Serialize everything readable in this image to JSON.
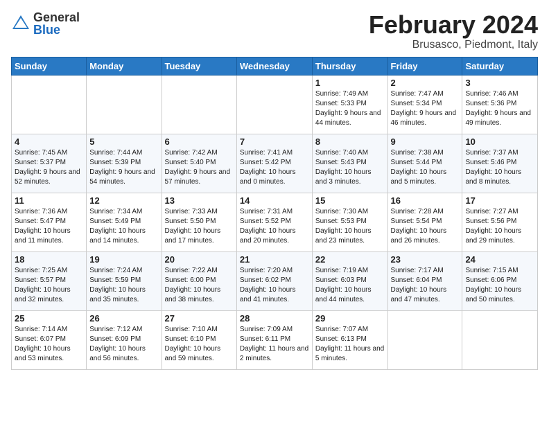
{
  "logo": {
    "general": "General",
    "blue": "Blue"
  },
  "header": {
    "month": "February 2024",
    "location": "Brusasco, Piedmont, Italy"
  },
  "weekdays": [
    "Sunday",
    "Monday",
    "Tuesday",
    "Wednesday",
    "Thursday",
    "Friday",
    "Saturday"
  ],
  "weeks": [
    [
      {
        "day": "",
        "info": ""
      },
      {
        "day": "",
        "info": ""
      },
      {
        "day": "",
        "info": ""
      },
      {
        "day": "",
        "info": ""
      },
      {
        "day": "1",
        "info": "Sunrise: 7:49 AM\nSunset: 5:33 PM\nDaylight: 9 hours and 44 minutes."
      },
      {
        "day": "2",
        "info": "Sunrise: 7:47 AM\nSunset: 5:34 PM\nDaylight: 9 hours and 46 minutes."
      },
      {
        "day": "3",
        "info": "Sunrise: 7:46 AM\nSunset: 5:36 PM\nDaylight: 9 hours and 49 minutes."
      }
    ],
    [
      {
        "day": "4",
        "info": "Sunrise: 7:45 AM\nSunset: 5:37 PM\nDaylight: 9 hours and 52 minutes."
      },
      {
        "day": "5",
        "info": "Sunrise: 7:44 AM\nSunset: 5:39 PM\nDaylight: 9 hours and 54 minutes."
      },
      {
        "day": "6",
        "info": "Sunrise: 7:42 AM\nSunset: 5:40 PM\nDaylight: 9 hours and 57 minutes."
      },
      {
        "day": "7",
        "info": "Sunrise: 7:41 AM\nSunset: 5:42 PM\nDaylight: 10 hours and 0 minutes."
      },
      {
        "day": "8",
        "info": "Sunrise: 7:40 AM\nSunset: 5:43 PM\nDaylight: 10 hours and 3 minutes."
      },
      {
        "day": "9",
        "info": "Sunrise: 7:38 AM\nSunset: 5:44 PM\nDaylight: 10 hours and 5 minutes."
      },
      {
        "day": "10",
        "info": "Sunrise: 7:37 AM\nSunset: 5:46 PM\nDaylight: 10 hours and 8 minutes."
      }
    ],
    [
      {
        "day": "11",
        "info": "Sunrise: 7:36 AM\nSunset: 5:47 PM\nDaylight: 10 hours and 11 minutes."
      },
      {
        "day": "12",
        "info": "Sunrise: 7:34 AM\nSunset: 5:49 PM\nDaylight: 10 hours and 14 minutes."
      },
      {
        "day": "13",
        "info": "Sunrise: 7:33 AM\nSunset: 5:50 PM\nDaylight: 10 hours and 17 minutes."
      },
      {
        "day": "14",
        "info": "Sunrise: 7:31 AM\nSunset: 5:52 PM\nDaylight: 10 hours and 20 minutes."
      },
      {
        "day": "15",
        "info": "Sunrise: 7:30 AM\nSunset: 5:53 PM\nDaylight: 10 hours and 23 minutes."
      },
      {
        "day": "16",
        "info": "Sunrise: 7:28 AM\nSunset: 5:54 PM\nDaylight: 10 hours and 26 minutes."
      },
      {
        "day": "17",
        "info": "Sunrise: 7:27 AM\nSunset: 5:56 PM\nDaylight: 10 hours and 29 minutes."
      }
    ],
    [
      {
        "day": "18",
        "info": "Sunrise: 7:25 AM\nSunset: 5:57 PM\nDaylight: 10 hours and 32 minutes."
      },
      {
        "day": "19",
        "info": "Sunrise: 7:24 AM\nSunset: 5:59 PM\nDaylight: 10 hours and 35 minutes."
      },
      {
        "day": "20",
        "info": "Sunrise: 7:22 AM\nSunset: 6:00 PM\nDaylight: 10 hours and 38 minutes."
      },
      {
        "day": "21",
        "info": "Sunrise: 7:20 AM\nSunset: 6:02 PM\nDaylight: 10 hours and 41 minutes."
      },
      {
        "day": "22",
        "info": "Sunrise: 7:19 AM\nSunset: 6:03 PM\nDaylight: 10 hours and 44 minutes."
      },
      {
        "day": "23",
        "info": "Sunrise: 7:17 AM\nSunset: 6:04 PM\nDaylight: 10 hours and 47 minutes."
      },
      {
        "day": "24",
        "info": "Sunrise: 7:15 AM\nSunset: 6:06 PM\nDaylight: 10 hours and 50 minutes."
      }
    ],
    [
      {
        "day": "25",
        "info": "Sunrise: 7:14 AM\nSunset: 6:07 PM\nDaylight: 10 hours and 53 minutes."
      },
      {
        "day": "26",
        "info": "Sunrise: 7:12 AM\nSunset: 6:09 PM\nDaylight: 10 hours and 56 minutes."
      },
      {
        "day": "27",
        "info": "Sunrise: 7:10 AM\nSunset: 6:10 PM\nDaylight: 10 hours and 59 minutes."
      },
      {
        "day": "28",
        "info": "Sunrise: 7:09 AM\nSunset: 6:11 PM\nDaylight: 11 hours and 2 minutes."
      },
      {
        "day": "29",
        "info": "Sunrise: 7:07 AM\nSunset: 6:13 PM\nDaylight: 11 hours and 5 minutes."
      },
      {
        "day": "",
        "info": ""
      },
      {
        "day": "",
        "info": ""
      }
    ]
  ]
}
